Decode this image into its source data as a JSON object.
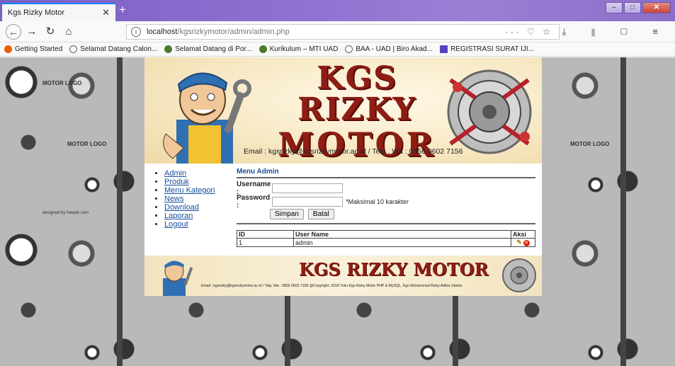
{
  "browser": {
    "tab_title": "Kgs Rizky Motor",
    "tab_close": "✕",
    "new_tab": "+",
    "url_host": "localhost",
    "url_path": "/kgsrizkymotor/admin/admin.php",
    "url_actions": "··· ♡ ☆",
    "toolbar_icons": "⤓ ⫴ ▢ ≡",
    "bookmarks": [
      {
        "label": "Getting Started",
        "color": "#e66000"
      },
      {
        "label": "Selamat Datang Calon...",
        "color": "#666666"
      },
      {
        "label": "Selamat Datang di Por...",
        "color": "#4c7a2a"
      },
      {
        "label": "Kurikulum – MTI UAD",
        "color": "#4c7a2a"
      },
      {
        "label": "BAA - UAD | Biro Akad...",
        "color": "#666666"
      },
      {
        "label": "REGISTRASI SURAT IJI...",
        "color": "#5a3fc0"
      }
    ]
  },
  "background_labels": [
    "MOTOR LOGO",
    "MOTOR LOGO",
    "MOTOR LOGO",
    "designed by freepik.com"
  ],
  "header": {
    "title_line1": "KGS RIZKY",
    "title_line2": "MOTOR",
    "contact": "Email : kgsrizky@kgsrizkymotor.ac.id / Telp , Wa : 0856 0602 7156"
  },
  "menu": [
    "Admin",
    "Produk",
    "Menu Kategori",
    "News",
    "Download",
    "Laporan",
    "Logout"
  ],
  "admin": {
    "title": "Menu Admin",
    "username_label": "Username :",
    "username_value": "",
    "password_label": "Password :",
    "password_value": "",
    "password_hint": "*Maksimal 10 karakter",
    "save_label": "Simpan",
    "cancel_label": "Batal",
    "table_headers": [
      "ID",
      "User Name",
      "Aksi"
    ],
    "rows": [
      {
        "id": "1",
        "username": "admin"
      }
    ]
  },
  "footer": {
    "title": "KGS RIZKY MOTOR",
    "text": "Email : kgsrizky@kgsrizkymotor.ac.id / Telp, Wa : 0856 0602 7156   @Copyright, 2018 Toko Kgs Rizky Motor PHP & MySQL, Kgs Muhammad Rizky Aditra Utama"
  }
}
